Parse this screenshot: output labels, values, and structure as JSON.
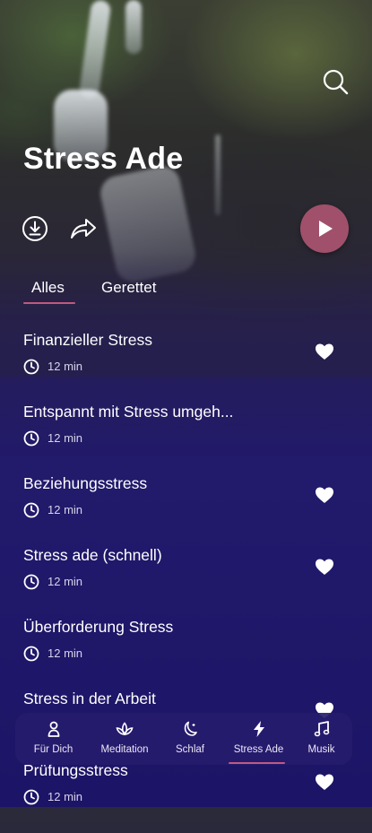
{
  "header": {
    "title": "Stress Ade",
    "icons": {
      "search": "search-icon",
      "download": "download-icon",
      "share": "share-icon",
      "play": "play-icon"
    }
  },
  "tabs": [
    {
      "label": "Alles",
      "selected": true
    },
    {
      "label": "Gerettet",
      "selected": false
    }
  ],
  "sessions": [
    {
      "title": "Finanzieller Stress",
      "duration": "12 min",
      "favorite_icon": "heart-icon"
    },
    {
      "title": "Entspannt mit Stress umgeh...",
      "duration": "12 min",
      "favorite_icon": ""
    },
    {
      "title": "Beziehungsstress",
      "duration": "12 min",
      "favorite_icon": "heart-icon"
    },
    {
      "title": "Stress ade (schnell)",
      "duration": "12 min",
      "favorite_icon": "heart-icon"
    },
    {
      "title": "Überforderung Stress",
      "duration": "12 min",
      "favorite_icon": ""
    },
    {
      "title": "Stress in der Arbeit",
      "duration": "12 min",
      "favorite_icon": "heart-icon"
    },
    {
      "title": "Prüfungsstress",
      "duration": "12 min",
      "favorite_icon": "heart-icon"
    }
  ],
  "bottom_nav": [
    {
      "label": "Für Dich",
      "icon": "person-icon",
      "selected": false
    },
    {
      "label": "Meditation",
      "icon": "lotus-icon",
      "selected": false
    },
    {
      "label": "Schlaf",
      "icon": "moon-icon",
      "selected": false
    },
    {
      "label": "Stress Ade",
      "icon": "lightning-icon",
      "selected": true
    },
    {
      "label": "Musik",
      "icon": "music-note-icon",
      "selected": false
    }
  ],
  "colors": {
    "accent": "#c05a7e",
    "play_button": "#a0506a",
    "background": "#221a6b"
  }
}
